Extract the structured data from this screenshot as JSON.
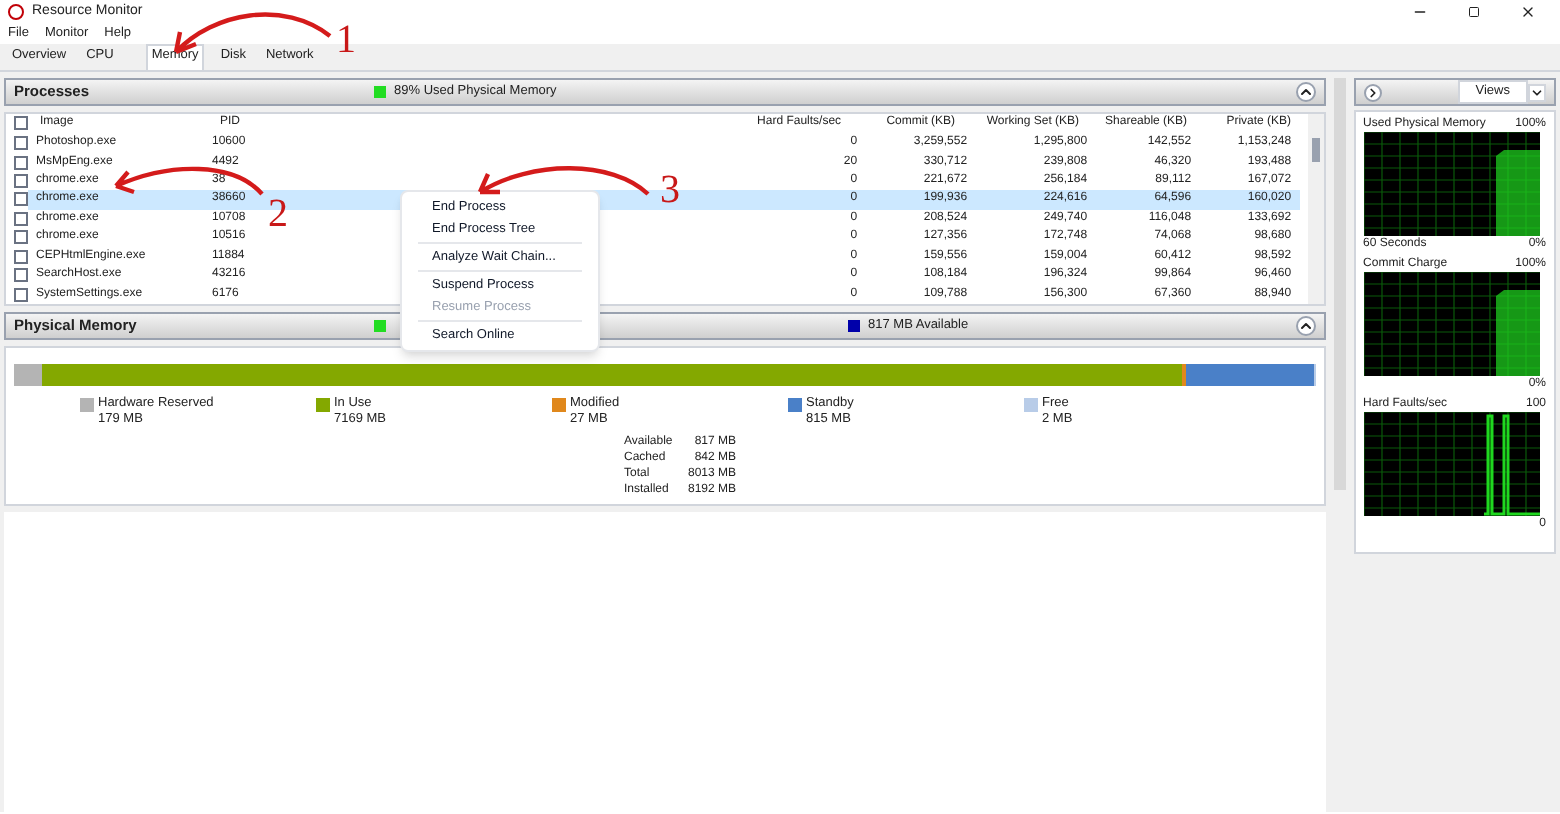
{
  "window": {
    "title": "Resource Monitor"
  },
  "menu": [
    "File",
    "Monitor",
    "Help"
  ],
  "tabs": [
    {
      "label": "Overview",
      "selected": false
    },
    {
      "label": "CPU",
      "selected": false
    },
    {
      "label": "Memory",
      "selected": true
    },
    {
      "label": "Disk",
      "selected": false
    },
    {
      "label": "Network",
      "selected": false
    }
  ],
  "processes": {
    "title": "Processes",
    "summary": "89% Used Physical Memory",
    "all_checked": false,
    "columns": [
      "Image",
      "PID",
      "Hard Faults/sec",
      "Commit (KB)",
      "Working Set (KB)",
      "Shareable (KB)",
      "Private (KB)"
    ],
    "rows": [
      {
        "image": "Photoshop.exe",
        "pid": "10600",
        "hard_faults": "0",
        "commit": "3,259,552",
        "working_set": "1,295,800",
        "shareable": "142,552",
        "private": "1,153,248",
        "checked": false,
        "selected": false
      },
      {
        "image": "MsMpEng.exe",
        "pid": "4492",
        "hard_faults": "20",
        "commit": "330,712",
        "working_set": "239,808",
        "shareable": "46,320",
        "private": "193,488",
        "checked": false,
        "selected": false
      },
      {
        "image": "chrome.exe",
        "pid": "38",
        "hard_faults": "0",
        "commit": "221,672",
        "working_set": "256,184",
        "shareable": "89,112",
        "private": "167,072",
        "checked": false,
        "selected": false
      },
      {
        "image": "chrome.exe",
        "pid": "38660",
        "hard_faults": "0",
        "commit": "199,936",
        "working_set": "224,616",
        "shareable": "64,596",
        "private": "160,020",
        "checked": false,
        "selected": true
      },
      {
        "image": "chrome.exe",
        "pid": "10708",
        "hard_faults": "0",
        "commit": "208,524",
        "working_set": "249,740",
        "shareable": "116,048",
        "private": "133,692",
        "checked": false,
        "selected": false
      },
      {
        "image": "chrome.exe",
        "pid": "10516",
        "hard_faults": "0",
        "commit": "127,356",
        "working_set": "172,748",
        "shareable": "74,068",
        "private": "98,680",
        "checked": false,
        "selected": false
      },
      {
        "image": "CEPHtmlEngine.exe",
        "pid": "11884",
        "hard_faults": "0",
        "commit": "159,556",
        "working_set": "159,004",
        "shareable": "60,412",
        "private": "98,592",
        "checked": false,
        "selected": false
      },
      {
        "image": "SearchHost.exe",
        "pid": "43216",
        "hard_faults": "0",
        "commit": "108,184",
        "working_set": "196,324",
        "shareable": "99,864",
        "private": "96,460",
        "checked": false,
        "selected": false
      },
      {
        "image": "SystemSettings.exe",
        "pid": "6176",
        "hard_faults": "0",
        "commit": "109,788",
        "working_set": "156,300",
        "shareable": "67,360",
        "private": "88,940",
        "checked": false,
        "selected": false
      }
    ]
  },
  "context_menu": [
    {
      "kind": "item",
      "label": "End Process",
      "disabled": false
    },
    {
      "kind": "item",
      "label": "End Process Tree",
      "disabled": false
    },
    {
      "kind": "separator"
    },
    {
      "kind": "item",
      "label": "Analyze Wait Chain...",
      "disabled": false
    },
    {
      "kind": "separator"
    },
    {
      "kind": "item",
      "label": "Suspend Process",
      "disabled": false
    },
    {
      "kind": "item",
      "label": "Resume Process",
      "disabled": true
    },
    {
      "kind": "separator"
    },
    {
      "kind": "item",
      "label": "Search Online",
      "disabled": false
    }
  ],
  "physical_memory": {
    "title": "Physical Memory",
    "summary": "817 MB Available",
    "segments": [
      {
        "label": "Hardware Reserved",
        "value": "179 MB",
        "color": "#b4b4b4"
      },
      {
        "label": "In Use",
        "value": "7169 MB",
        "color": "#84a800"
      },
      {
        "label": "Modified",
        "value": "27 MB",
        "color": "#e0881c"
      },
      {
        "label": "Standby",
        "value": "815 MB",
        "color": "#4a80c8"
      },
      {
        "label": "Free",
        "value": "2 MB",
        "color": "#b8cce8"
      }
    ],
    "stats": [
      {
        "label": "Available",
        "value": "817 MB"
      },
      {
        "label": "Cached",
        "value": "842 MB"
      },
      {
        "label": "Total",
        "value": "8013 MB"
      },
      {
        "label": "Installed",
        "value": "8192 MB"
      }
    ]
  },
  "side": {
    "views": "Views",
    "graphs": [
      {
        "title": "Used Physical Memory",
        "max": "100%",
        "min": "0%",
        "footer": "60 Seconds",
        "kind": "area"
      },
      {
        "title": "Commit Charge",
        "max": "100%",
        "min": "0%",
        "kind": "area"
      },
      {
        "title": "Hard Faults/sec",
        "max": "100",
        "min": "0",
        "kind": "spikes"
      }
    ]
  },
  "annotations": [
    "1",
    "2",
    "3"
  ]
}
